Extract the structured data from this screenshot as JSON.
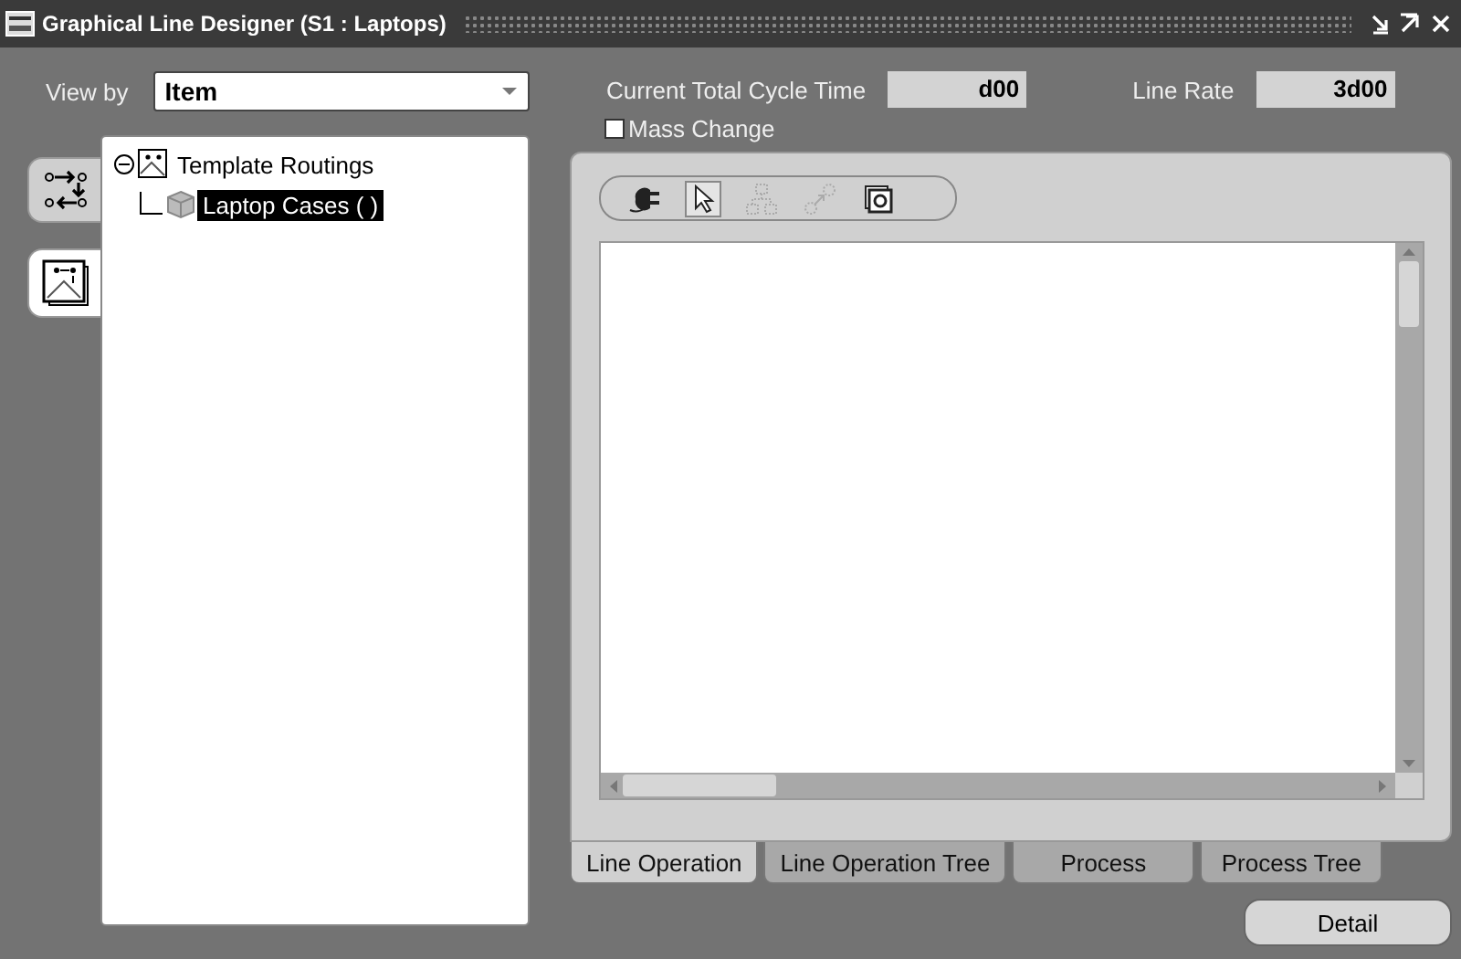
{
  "window": {
    "title": "Graphical Line Designer (S1 : Laptops)"
  },
  "view_by": {
    "label": "View by",
    "value": "Item"
  },
  "side_tabs": [
    {
      "kind": "flow",
      "selected": false
    },
    {
      "kind": "diagram",
      "selected": true
    }
  ],
  "tree": [
    {
      "label": "Template Routings",
      "expanded": true,
      "kind": "folder",
      "selected": false,
      "children": [
        {
          "label": "Laptop Cases ( )",
          "kind": "item",
          "selected": true
        }
      ]
    }
  ],
  "cycle_time": {
    "label": "Current Total Cycle Time",
    "value": "d00"
  },
  "line_rate": {
    "label": "Line Rate",
    "value": "3d00"
  },
  "mass_change": {
    "label": "Mass Change",
    "checked": false
  },
  "toolbar": [
    {
      "kind": "plug",
      "selected": false,
      "disabled": false
    },
    {
      "kind": "pointer",
      "selected": true,
      "disabled": false
    },
    {
      "kind": "network",
      "selected": false,
      "disabled": true
    },
    {
      "kind": "connect",
      "selected": false,
      "disabled": true
    },
    {
      "kind": "properties",
      "selected": false,
      "disabled": false
    }
  ],
  "tabs": [
    {
      "label": "Line Operation",
      "selected": true
    },
    {
      "label": "Line Operation Tree",
      "selected": false
    },
    {
      "label": "Process",
      "selected": false
    },
    {
      "label": "Process Tree",
      "selected": false
    }
  ],
  "buttons": [
    {
      "label": "Detail"
    }
  ]
}
